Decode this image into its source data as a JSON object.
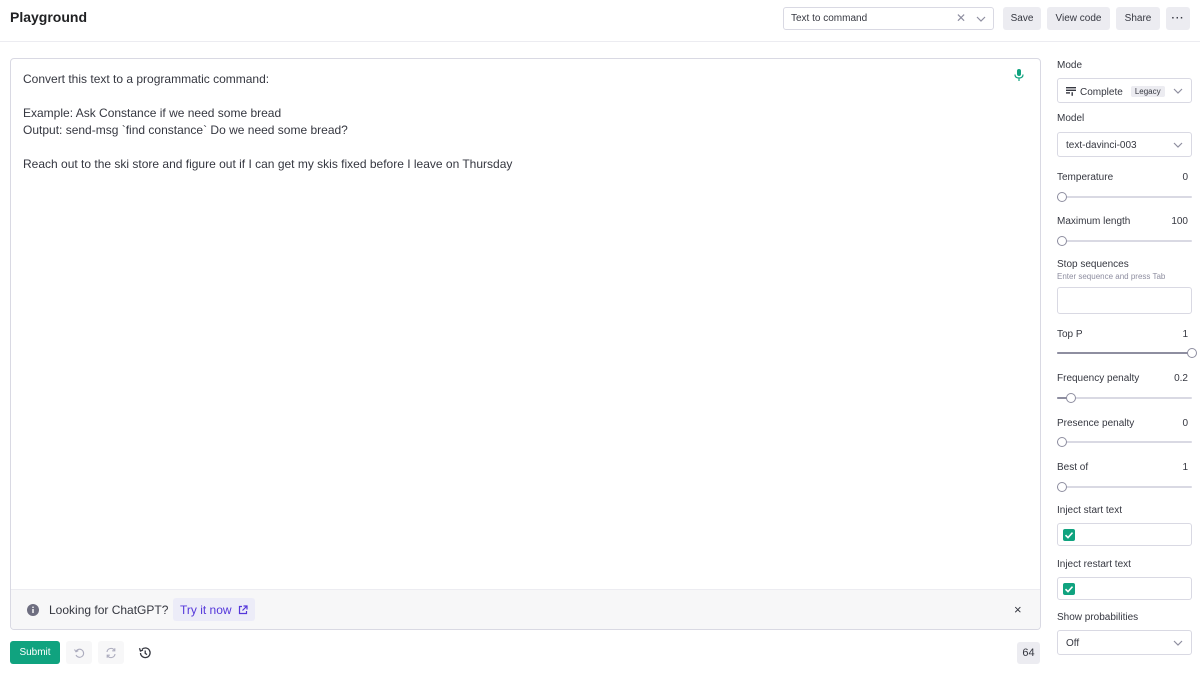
{
  "header": {
    "title": "Playground",
    "preset": "Text to command",
    "save_label": "Save",
    "view_code_label": "View code",
    "share_label": "Share",
    "more_label": "···"
  },
  "editor": {
    "prompt": "Convert this text to a programmatic command:\n\nExample: Ask Constance if we need some bread\nOutput: send-msg `find constance` Do we need some bread?\n\nReach out to the ski store and figure out if I can get my skis fixed before I leave on Thursday"
  },
  "banner": {
    "text": "Looking for ChatGPT?",
    "link_label": "Try it now",
    "close_label": "×"
  },
  "footer": {
    "submit_label": "Submit",
    "token_count": "64"
  },
  "panel": {
    "mode": {
      "label": "Mode",
      "value": "Complete",
      "badge": "Legacy"
    },
    "model": {
      "label": "Model",
      "value": "text-davinci-003"
    },
    "temperature": {
      "label": "Temperature",
      "value": "0",
      "fraction": 0.0
    },
    "max_length": {
      "label": "Maximum length",
      "value": "100",
      "fraction": 0.0
    },
    "stop_sequences": {
      "label": "Stop sequences",
      "hint": "Enter sequence and press Tab"
    },
    "top_p": {
      "label": "Top P",
      "value": "1",
      "fraction": 1.0
    },
    "frequency_penalty": {
      "label": "Frequency penalty",
      "value": "0.2",
      "fraction": 0.1
    },
    "presence_penalty": {
      "label": "Presence penalty",
      "value": "0",
      "fraction": 0.0
    },
    "best_of": {
      "label": "Best of",
      "value": "1",
      "fraction": 0.0
    },
    "inject_start": {
      "label": "Inject start text",
      "checked": true
    },
    "inject_restart": {
      "label": "Inject restart text",
      "checked": true
    },
    "show_probabilities": {
      "label": "Show probabilities",
      "value": "Off"
    }
  },
  "colors": {
    "accent": "#10a37f",
    "link": "#5436da"
  }
}
